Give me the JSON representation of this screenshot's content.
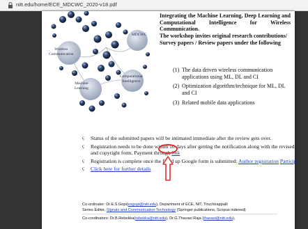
{
  "address_bar": {
    "url": "nitt.edu/home/ECE_MDCWC_2020-v18.pdf"
  },
  "graphic": {
    "labels": {
      "wireless": [
        "Wireless",
        "Communication"
      ],
      "mdcwc": "MDCWC",
      "machine": [
        "Machine",
        "Learning"
      ],
      "computational": [
        "Computational",
        "Intelligence"
      ]
    }
  },
  "intro": {
    "lines": [
      "Integrating the Machine Learning, Deep Learning and",
      "Computational     Intelligence     for     Wireless",
      "Communication.",
      "The workshop invites original research contributions/",
      "Survey papers / Review papers under the following"
    ]
  },
  "topics": [
    {
      "num": "(1)",
      "lines": [
        "The data driven wireless communication",
        "applications using ML, DL and CI"
      ]
    },
    {
      "num": "(2)",
      "lines": [
        "Optimization algorithm/technique for ML, DL",
        "and CI"
      ]
    },
    {
      "num": "(3)",
      "lines": [
        "Related mobile data applications"
      ]
    }
  ],
  "bullets": {
    "check_glyph": "ç",
    "status": "Status of the submitted papers will be intimated immediate after the review gets over.",
    "registration_days_1": "Registration needs to be done within 10 days after getting the notification along with the revised paper",
    "registration_days_2a": "and copyright form. Payment through ",
    "payment_link": "link",
    "registration_complete_a": "Registration is complete once the filled up Google form is submitted: ",
    "author_registration_link": "Author registration",
    "participants_link": "Participants",
    "further_details_link": "Click here for further details"
  },
  "coordinators": {
    "line1_a": "Co-ordinator: Dr.E.S.Gopi(",
    "email_gopi": "esgopi@nitt.edu",
    "line1_b": "), Department of ECE, NIT, Tiruchirappalli",
    "line2_a": "Series Editor, ",
    "series_link": "Signals and Communication Technology",
    "line2_b": " (Springer publications, Scopus indexed)",
    "line3_a": "Co-cordinators: Dr.B.Rebekka(",
    "email_rebekka": "rebekka@nitt.edu",
    "line3_b": "), Dr.G.Thavasi Raja (",
    "email_thavasi": "thavasi@nitt.edu",
    "line3_c": "),"
  },
  "colors": {
    "link": "#1a3fbf",
    "annotation": "#e03030",
    "node": "#1f3352"
  }
}
